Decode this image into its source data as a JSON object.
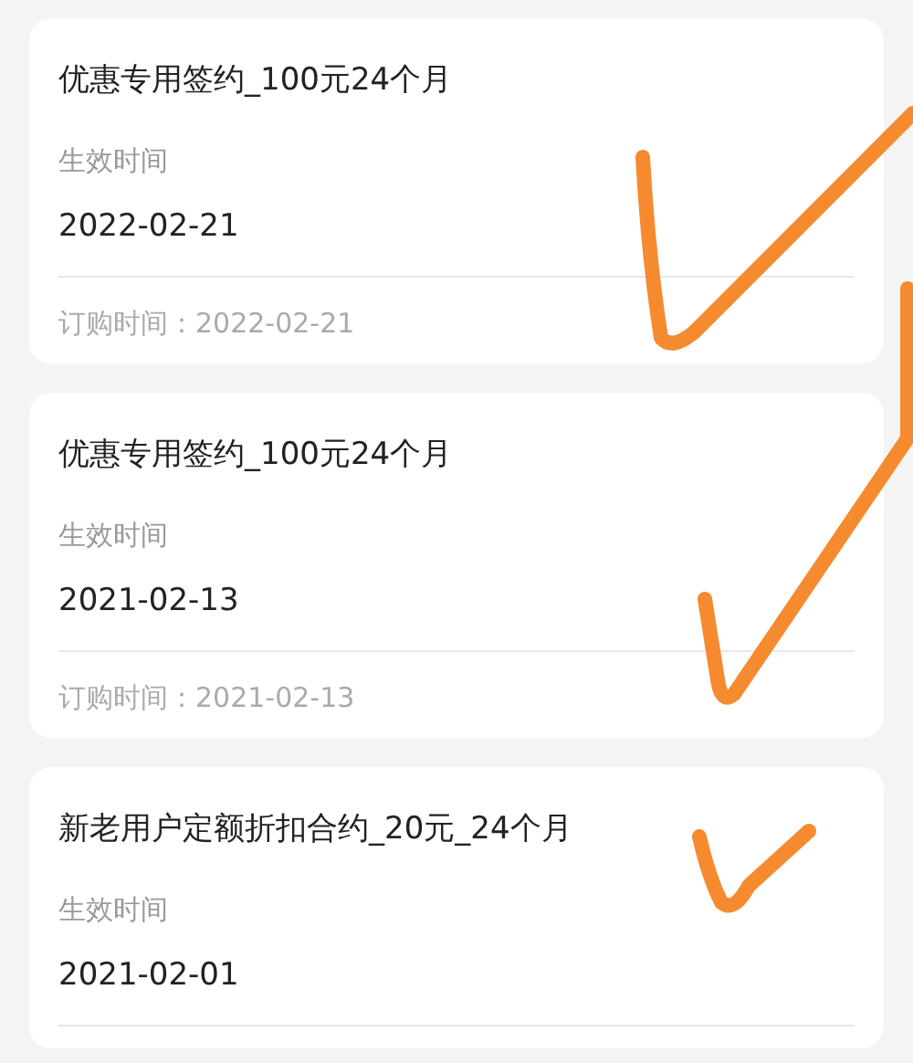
{
  "orders": [
    {
      "title": "优惠专用签约_100元24个月",
      "effective_label": "生效时间",
      "effective_date": "2022-02-21",
      "order_time": "订购时间：2022-02-21"
    },
    {
      "title": "优惠专用签约_100元24个月",
      "effective_label": "生效时间",
      "effective_date": "2021-02-13",
      "order_time": "订购时间：2021-02-13"
    },
    {
      "title": "新老用户定额折扣合约_20元_24个月",
      "effective_label": "生效时间",
      "effective_date": "2021-02-01"
    }
  ],
  "handwritten_marks": [
    {
      "kind": "check"
    },
    {
      "kind": "check"
    },
    {
      "kind": "check"
    }
  ]
}
